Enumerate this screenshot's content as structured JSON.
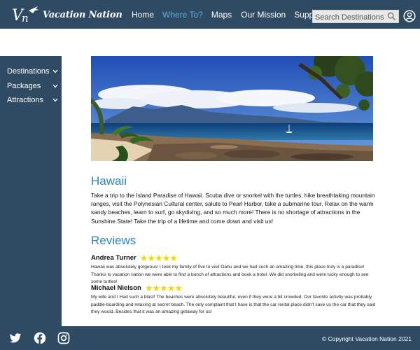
{
  "header": {
    "logo_mark": "Vn",
    "brand_name": "Vacation Nation",
    "nav": [
      {
        "label": "Home",
        "active": false
      },
      {
        "label": "Where To?",
        "active": true
      },
      {
        "label": "Maps",
        "active": false
      },
      {
        "label": "Our Mission",
        "active": false
      },
      {
        "label": "Support",
        "active": false
      }
    ],
    "search": {
      "placeholder": "Search Destinations",
      "value": "",
      "icon": "search-icon"
    },
    "user_icon": "user-circle-icon"
  },
  "sidebar": {
    "items": [
      {
        "label": "Destinations",
        "icon": "chevron-down-icon"
      },
      {
        "label": "Packages",
        "icon": "chevron-down-icon"
      },
      {
        "label": "Attractions",
        "icon": "chevron-down-icon"
      }
    ]
  },
  "main": {
    "title": "Hawaii",
    "description": "Take a trip to the Island Paradise of Hawaii. Scuba dive or snorkel with the turtles, hike breathtaking mountain ranges, visit the Polynesian Cultural center, salute to Pearl Harbor, take a submarine tour, Relax on the warm sandy beaches, learn to surf, go skydiving, and so much more! There is no shortage of attractions in the Sunshine State! Take the trip of a lifetime and come down and visit us!",
    "reviews_title": "Reviews",
    "reviews": [
      {
        "name": "Andrea Turner",
        "rating": 5,
        "stars": "★★★★★",
        "text": "Hawaii was absolutely gorgeous! I took my family of five to visit Oahu and we had such an amazing time, this place truly is a paradise! Thanks to vacation nation we were able to find a bunch of attractions and book a hotel. We did snorkeling and were lucky enough to see some turtles!"
      },
      {
        "name": "Michael Nielson",
        "rating": 5,
        "stars": "★★★★★",
        "text": "My wife and I Had such a blast! The beaches were absolutely beautiful, even if they were a bit crowded. Our favorite activity was probably paddle-boarding and relaxing at secret beach. The only complaint that I have is that the car rental place didn't save us the car that they said they would. Besides that it was an amazing getaway for us!"
      }
    ]
  },
  "footer": {
    "social": [
      {
        "icon": "twitter-icon"
      },
      {
        "icon": "facebook-icon"
      },
      {
        "icon": "instagram-icon"
      }
    ],
    "copyright": "© Copyright Vacation Nation 2021"
  },
  "colors": {
    "header_bg": "#2f4a63",
    "accent": "#2c83bf",
    "nav_active": "#5ab0e0",
    "stars": "#f1d900"
  }
}
